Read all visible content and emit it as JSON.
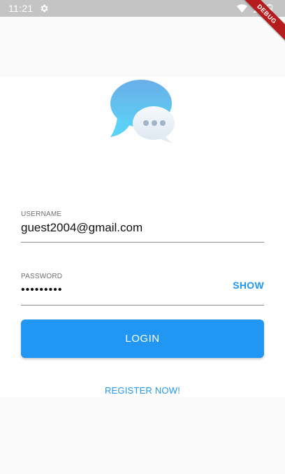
{
  "status_bar": {
    "time": "11:21",
    "icons": [
      "gear-icon",
      "wifi-icon",
      "signal-icon",
      "battery-icon"
    ]
  },
  "debug_banner": "DEBUG",
  "logo": {
    "icon": "chat-bubbles-icon",
    "colors": {
      "bubble_top": "#6aaee8",
      "bubble_bottom": "#5cd0f5",
      "small_bubble": "#eef3f8",
      "dots": "#9fb4c8"
    }
  },
  "form": {
    "username": {
      "label": "USERNAME",
      "value": "guest2004@gmail.com"
    },
    "password": {
      "label": "PASSWORD",
      "value": "•••••••••",
      "toggle_label": "SHOW"
    },
    "login_label": "LOGIN",
    "register_label": "REGISTER NOW!"
  },
  "colors": {
    "accent": "#2196f3",
    "status_bar": "#c4c4c4",
    "background": "#fafafa",
    "card": "#ffffff"
  }
}
